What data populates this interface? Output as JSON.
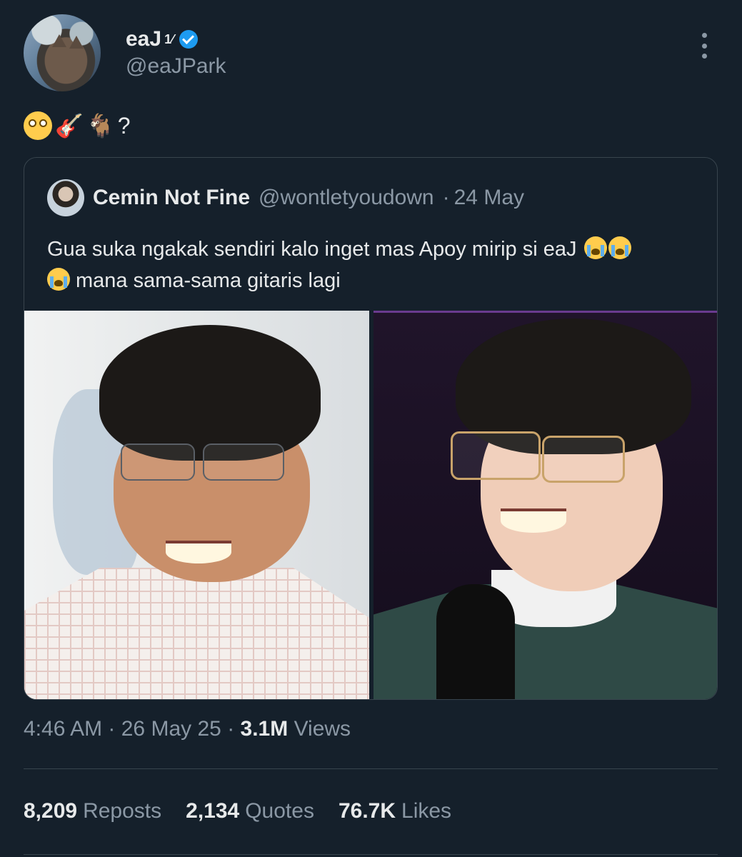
{
  "author": {
    "display_name": "eaJ",
    "name_suffix": "1⁄",
    "handle": "@eaJPark",
    "verified_icon": "verified-badge-icon"
  },
  "tweet": {
    "emojis": [
      "flushed-face",
      "guitar",
      "goat"
    ],
    "text_suffix": "?"
  },
  "quote": {
    "display_name": "Cemin Not Fine",
    "handle": "@wontletyoudown",
    "separator": "·",
    "date": "24 May",
    "text_line1": "Gua suka ngakak sendiri kalo inget mas Apoy mirip si eaJ",
    "text_line2": "mana sama-sama gitaris lagi"
  },
  "meta": {
    "time": "4:46 AM",
    "date": "26 May 25",
    "views_count": "3.1M",
    "views_label": "Views"
  },
  "stats": {
    "reposts_count": "8,209",
    "reposts_label": "Reposts",
    "quotes_count": "2,134",
    "quotes_label": "Quotes",
    "likes_count": "76.7K",
    "likes_label": "Likes"
  },
  "colors": {
    "background": "#15202b",
    "text": "#e7e9ea",
    "secondary": "#8b98a5",
    "accent": "#1d9bf0",
    "border": "#38444d"
  }
}
